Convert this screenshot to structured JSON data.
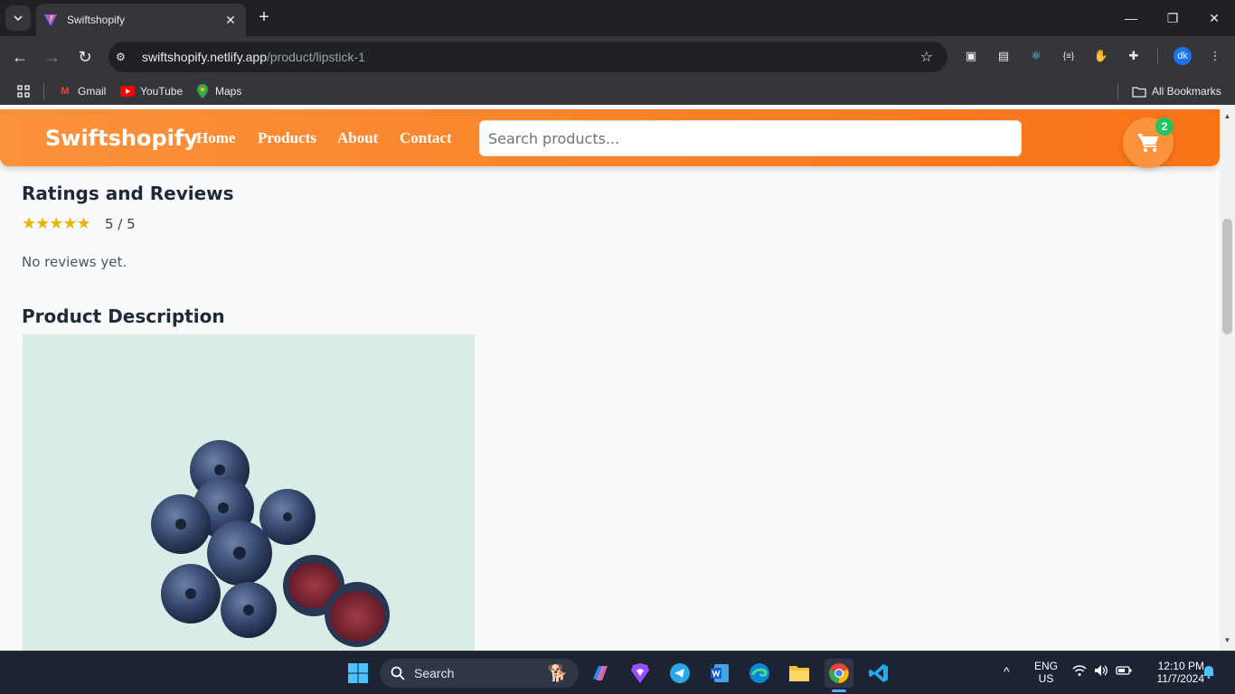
{
  "browser": {
    "tab_title": "Swiftshopify",
    "url_host": "swiftshopify.netlify.app",
    "url_path": "/product/lipstick-1",
    "profile_initials": "dk",
    "bookmarks": [
      {
        "label": "Gmail"
      },
      {
        "label": "YouTube"
      },
      {
        "label": "Maps"
      }
    ],
    "all_bookmarks": "All Bookmarks"
  },
  "site": {
    "brand": "Swiftshopify",
    "nav": {
      "home": "Home",
      "products": "Products",
      "about": "About",
      "contact": "Contact"
    },
    "search_placeholder": "Search products...",
    "cart_count": "2"
  },
  "reviews": {
    "heading": "Ratings and Reviews",
    "stars": "★★★★★",
    "rating_value": 5,
    "rating_text": "5 / 5",
    "empty_text": "No reviews yet."
  },
  "description": {
    "heading": "Product Description"
  },
  "taskbar": {
    "search_label": "Search",
    "lang_top": "ENG",
    "lang_bottom": "US",
    "time": "12:10 PM",
    "date": "11/7/2024"
  },
  "colors": {
    "header_start": "#fb923c",
    "header_end": "#f97316",
    "star": "#eab308",
    "badge": "#22c55e"
  }
}
